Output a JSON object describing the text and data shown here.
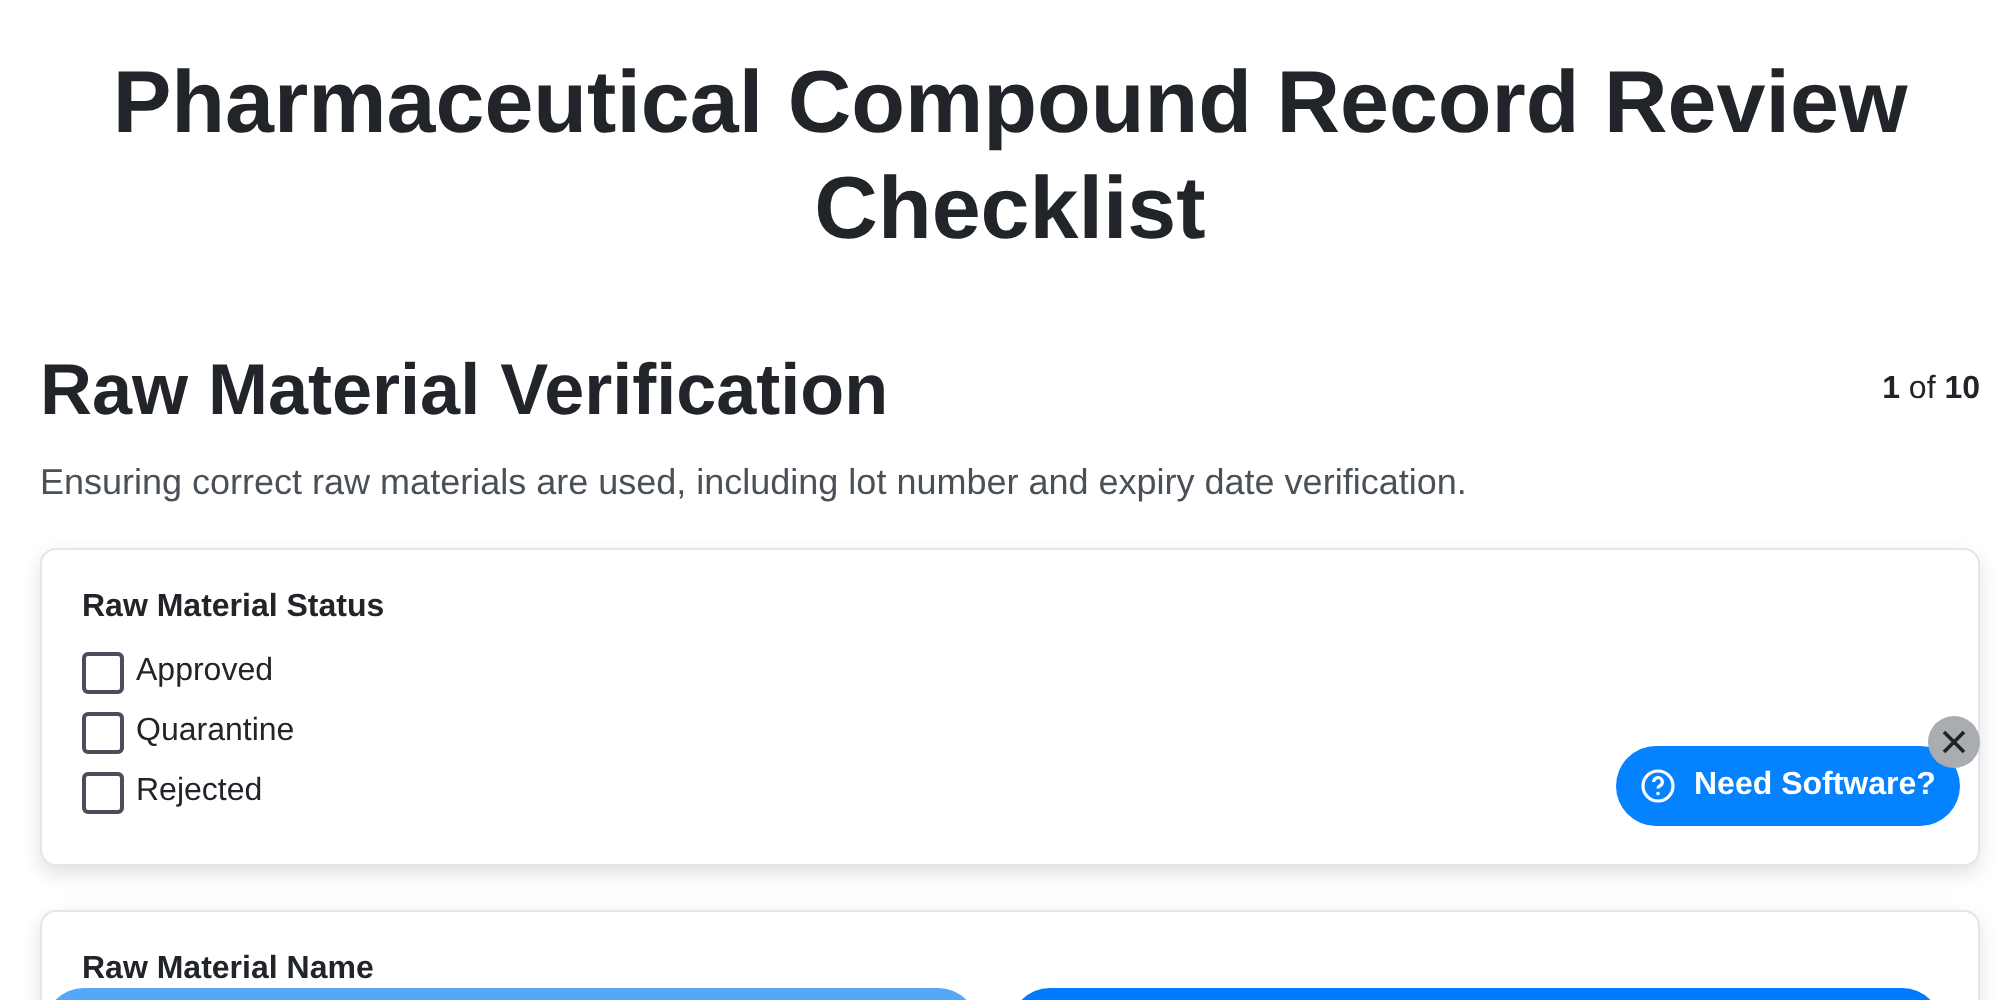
{
  "title": "Pharmaceutical Compound Record Review Checklist",
  "section": {
    "heading": "Raw Material Verification",
    "counter": "**1** of **10**",
    "description": "Ensuring correct raw materials are used, including lot number and expiry date verification."
  },
  "cards": [
    {
      "label": "Raw Material Status",
      "options": [
        {
          "label": "Approved",
          "checked": false
        },
        {
          "label": "Quarantine",
          "checked": false
        },
        {
          "label": "Rejected",
          "checked": false
        }
      ]
    },
    {
      "label": "Raw Material Name"
    }
  ],
  "help_widget": {
    "label": "Need Software?"
  }
}
